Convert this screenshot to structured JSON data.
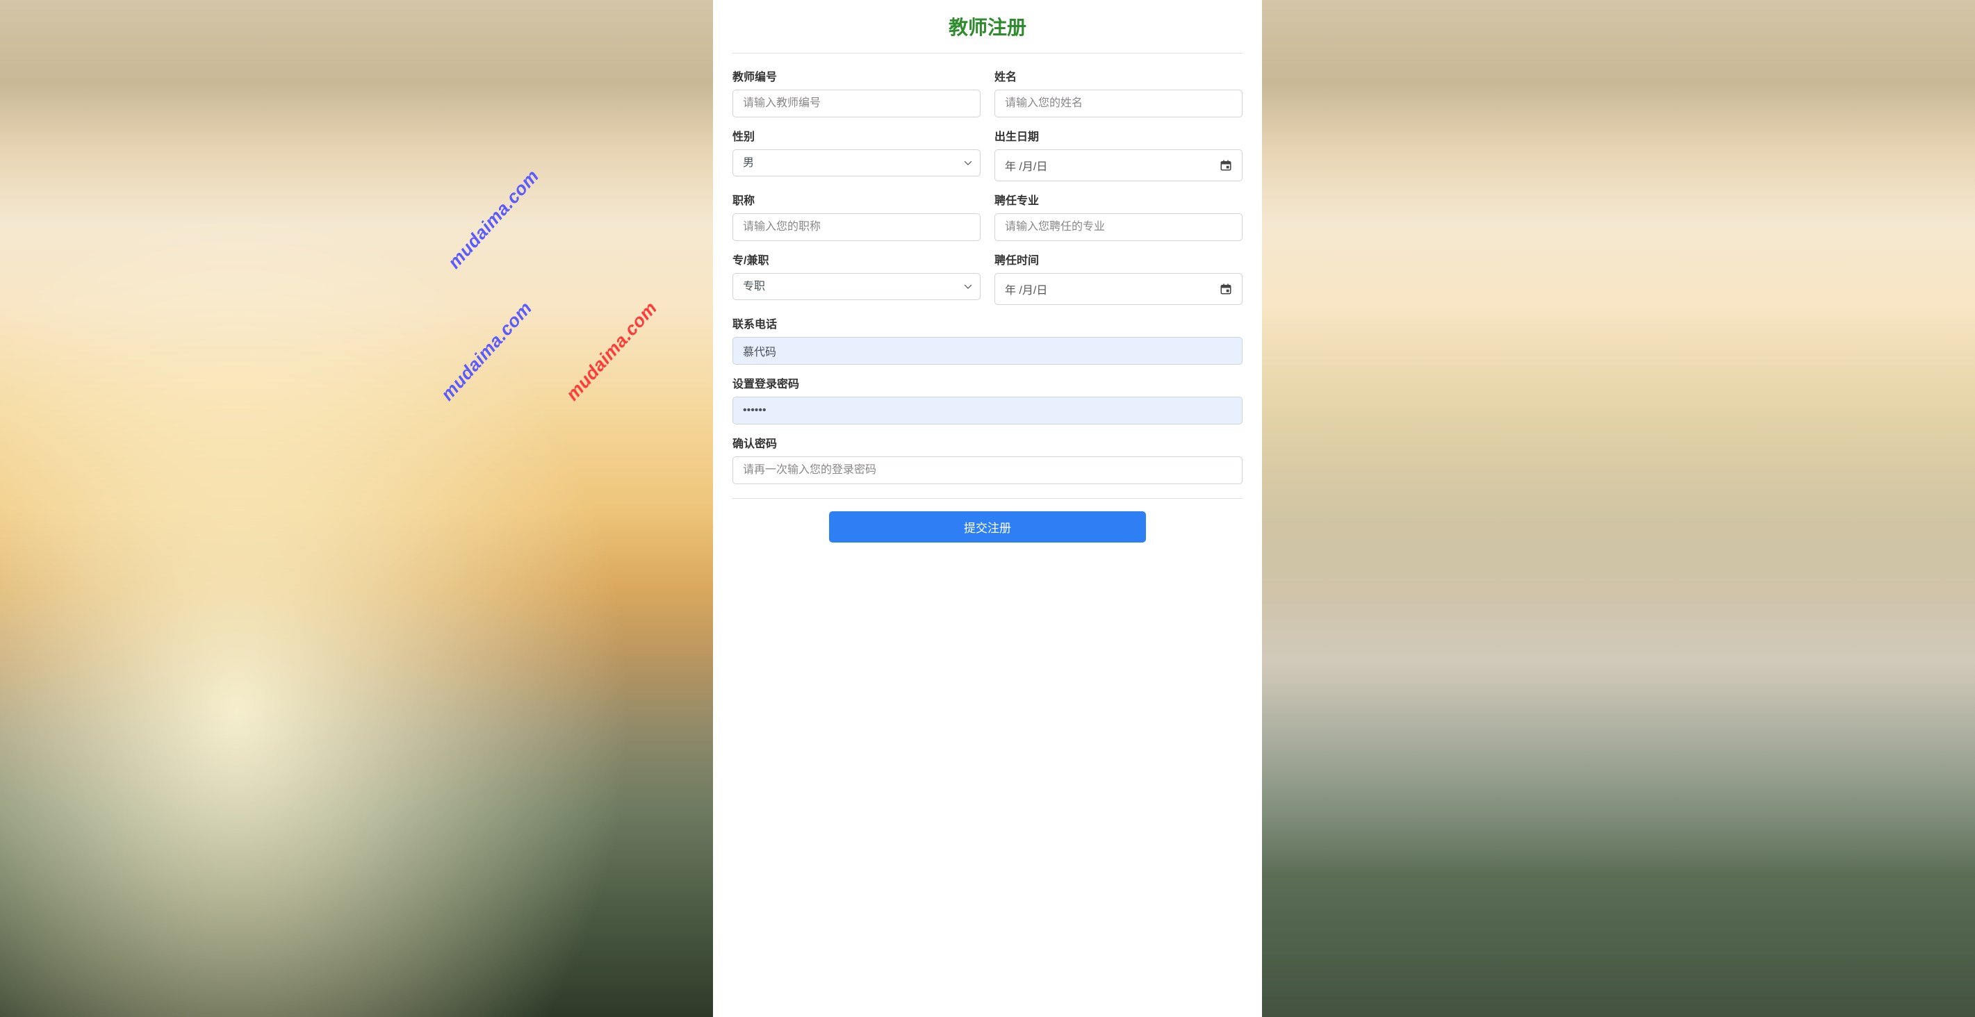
{
  "page": {
    "title": "教师注册"
  },
  "form": {
    "teacher_id": {
      "label": "教师编号",
      "placeholder": "请输入教师编号",
      "value": ""
    },
    "name": {
      "label": "姓名",
      "placeholder": "请输入您的姓名",
      "value": ""
    },
    "gender": {
      "label": "性别",
      "value": "男"
    },
    "birth_date": {
      "label": "出生日期",
      "placeholder": "年 /月/日",
      "value": ""
    },
    "title": {
      "label": "职称",
      "placeholder": "请输入您的职称",
      "value": ""
    },
    "major": {
      "label": "聘任专业",
      "placeholder": "请输入您聘任的专业",
      "value": ""
    },
    "employment_type": {
      "label": "专/兼职",
      "value": "专职"
    },
    "hire_date": {
      "label": "聘任时间",
      "placeholder": "年 /月/日",
      "value": ""
    },
    "phone": {
      "label": "联系电话",
      "placeholder": "",
      "value": "慕代码"
    },
    "password": {
      "label": "设置登录密码",
      "placeholder": "",
      "value": "••••••"
    },
    "confirm_password": {
      "label": "确认密码",
      "placeholder": "请再一次输入您的登录密码",
      "value": ""
    }
  },
  "buttons": {
    "submit": "提交注册"
  },
  "watermarks": {
    "text": "mudaima.com"
  }
}
